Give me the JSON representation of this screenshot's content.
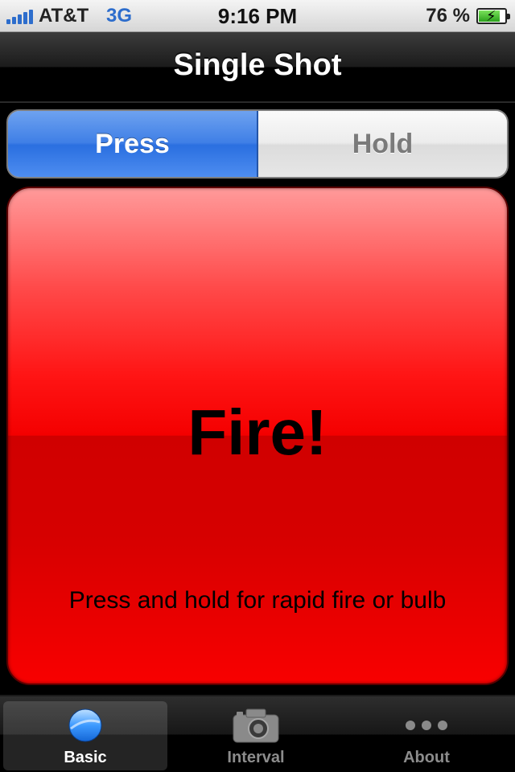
{
  "status_bar": {
    "carrier": "AT&T",
    "network": "3G",
    "time": "9:16 PM",
    "battery_percent": "76 %",
    "battery_level": 0.76
  },
  "nav_bar": {
    "title": "Single Shot"
  },
  "segmented_control": {
    "options": [
      "Press",
      "Hold"
    ],
    "selected": "Press"
  },
  "fire_button": {
    "label": "Fire!",
    "hint": "Press and hold for rapid fire or bulb",
    "color": "#ff0000"
  },
  "tab_bar": {
    "tabs": [
      {
        "label": "Basic",
        "icon": "ball-icon",
        "active": true
      },
      {
        "label": "Interval",
        "icon": "camera-icon",
        "active": false
      },
      {
        "label": "About",
        "icon": "more-dots-icon",
        "active": false
      }
    ]
  },
  "colors": {
    "accent": "#3f7fe6",
    "fire_red": "#f40000"
  }
}
